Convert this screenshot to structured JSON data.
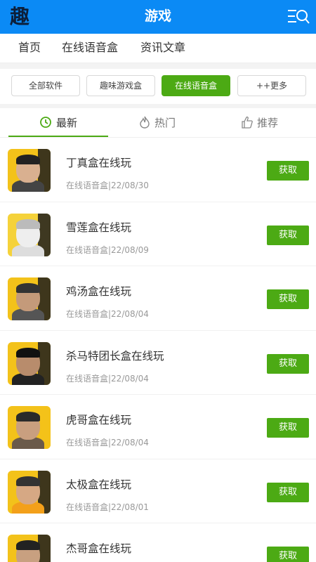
{
  "header": {
    "logo": "趣",
    "title": "游戏",
    "menu_icon": "menu-search-icon"
  },
  "nav": {
    "items": [
      "首页",
      "在线语音盒",
      "资讯文章"
    ]
  },
  "filters": {
    "items": [
      "全部软件",
      "趣味游戏盒",
      "在线语音盒",
      "++更多"
    ],
    "active_index": 2
  },
  "tabs": {
    "items": [
      "最新",
      "热门",
      "推荐"
    ],
    "active_index": 0
  },
  "colors": {
    "header_bg": "#0b8af5",
    "accent": "#4caa14"
  },
  "list": {
    "button_label": "获取",
    "items": [
      {
        "title": "丁真盒在线玩",
        "subtitle": "在线语音盒|22/08/30"
      },
      {
        "title": "雪莲盒在线玩",
        "subtitle": "在线语音盒|22/08/09"
      },
      {
        "title": "鸡汤盒在线玩",
        "subtitle": "在线语音盒|22/08/04"
      },
      {
        "title": "杀马特团长盒在线玩",
        "subtitle": "在线语音盒|22/08/04"
      },
      {
        "title": "虎哥盒在线玩",
        "subtitle": "在线语音盒|22/08/04"
      },
      {
        "title": "太极盒在线玩",
        "subtitle": "在线语音盒|22/08/01"
      },
      {
        "title": "杰哥盒在线玩",
        "subtitle": ""
      }
    ]
  }
}
